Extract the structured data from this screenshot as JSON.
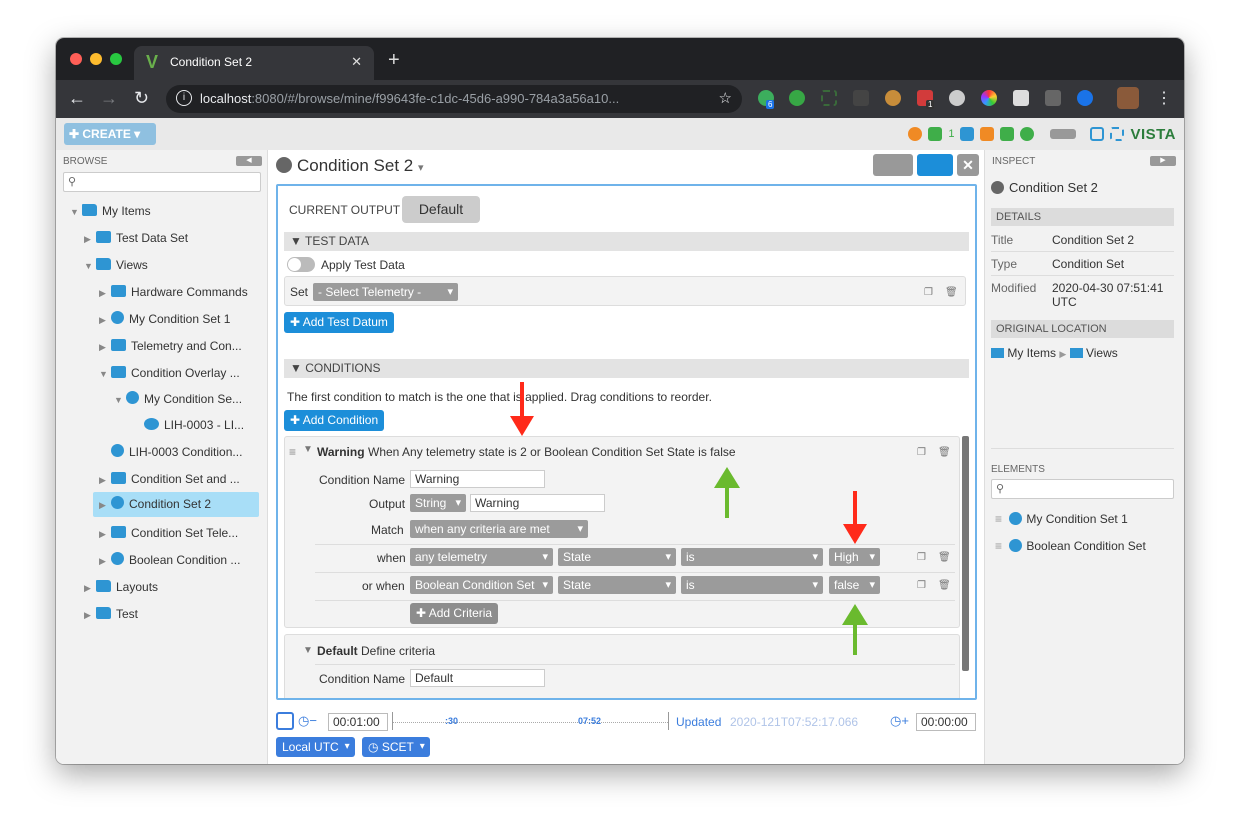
{
  "browser": {
    "tab_title": "Condition Set 2",
    "tab_logo": "V",
    "url_host": "localhost",
    "url_rest": ":8080/#/browse/mine/f99643fe-c1dc-45d6-a990-784a3a56a10...",
    "ext_badge_1": "6",
    "ext_badge_2": "1"
  },
  "app": {
    "create_label": "CREATE",
    "indicator_count": "1",
    "brand": "VISTA"
  },
  "browse": {
    "label": "BROWSE",
    "items": [
      {
        "label": "My Items"
      },
      {
        "label": "Test Data Set"
      },
      {
        "label": "Views"
      },
      {
        "label": "Hardware Commands"
      },
      {
        "label": "My Condition Set 1"
      },
      {
        "label": "Telemetry and Con..."
      },
      {
        "label": "Condition Overlay ..."
      },
      {
        "label": "My Condition Se..."
      },
      {
        "label": "LIH-0003 - LI..."
      },
      {
        "label": "LIH-0003 Condition..."
      },
      {
        "label": "Condition Set and ..."
      },
      {
        "label": "Condition Set 2"
      },
      {
        "label": "Condition Set Tele..."
      },
      {
        "label": "Boolean Condition ..."
      },
      {
        "label": "Layouts"
      },
      {
        "label": "Test"
      }
    ]
  },
  "main": {
    "title": "Condition Set 2",
    "current_output_label": "CURRENT OUTPUT",
    "current_output_value": "Default",
    "test_data": {
      "header": "TEST DATA",
      "apply_label": "Apply Test Data",
      "set_label": "Set",
      "select_placeholder": "- Select Telemetry -",
      "add_btn": "Add Test Datum"
    },
    "conditions": {
      "header": "CONDITIONS",
      "description": "The first condition to match is the one that is applied. Drag conditions to reorder.",
      "add_btn": "Add Condition",
      "warning": {
        "name_bold": "Warning",
        "summary": "When Any telemetry state is 2 or Boolean Condition Set State is false",
        "name_label": "Condition Name",
        "name_value": "Warning",
        "output_label": "Output",
        "output_type": "String",
        "output_value": "Warning",
        "match_label": "Match",
        "match_value": "when any criteria are met",
        "criteria": [
          {
            "prefix": "when",
            "telemetry": "any telemetry",
            "metadata": "State",
            "operation": "is",
            "value": "High"
          },
          {
            "prefix": "or when",
            "telemetry": "Boolean Condition Set",
            "metadata": "State",
            "operation": "is",
            "value": "false"
          }
        ],
        "add_criteria": "Add Criteria"
      },
      "default": {
        "name_bold": "Default",
        "summary": "Define criteria",
        "name_label": "Condition Name",
        "name_value": "Default"
      }
    }
  },
  "time_conductor": {
    "start_offset": "00:01:00",
    "tick_1": ":30",
    "tick_2": "07:52",
    "updated_label": "Updated",
    "updated_time": "2020-121T07:52:17.066",
    "end_offset": "00:00:00",
    "time_system": "Local UTC",
    "clock": "SCET"
  },
  "inspect": {
    "label": "INSPECT",
    "object_name": "Condition Set 2",
    "details_header": "DETAILS",
    "title_label": "Title",
    "title_value": "Condition Set 2",
    "type_label": "Type",
    "type_value": "Condition Set",
    "modified_label": "Modified",
    "modified_value": "2020-04-30 07:51:41 UTC",
    "location_header": "ORIGINAL LOCATION",
    "location_1": "My Items",
    "location_2": "Views",
    "elements_label": "ELEMENTS",
    "elements": [
      "My Condition Set 1",
      "Boolean Condition Set"
    ]
  },
  "colors": {
    "accent_blue": "#1c8ed9",
    "annotation_red": "#ff2a1a",
    "annotation_green": "#6aba2e"
  }
}
